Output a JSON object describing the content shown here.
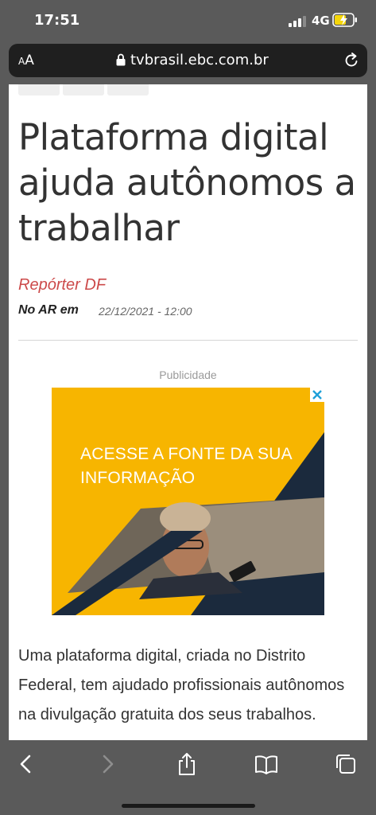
{
  "status_bar": {
    "time": "17:51",
    "network": "4G"
  },
  "browser": {
    "aa_small": "A",
    "aa_large": "A",
    "url": "tvbrasil.ebc.com.br"
  },
  "article": {
    "title": "Plataforma digital ajuda autônomos a trabalhar",
    "reporter": "Repórter DF",
    "on_air_label": "No AR em",
    "date": "22/12/2021 - 12:00",
    "ad_label": "Publicidade",
    "body": "Uma plataforma digital, criada no Distrito Federal, tem ajudado profissionais autônomos na divulgação gratuita dos seus trabalhos."
  },
  "ad": {
    "headline": "ACESSE A FONTE DA SUA INFORMAÇÃO"
  },
  "colors": {
    "accent": "#cc4a4a",
    "ad_background": "#f7b500",
    "ad_dark": "#1b2a3d"
  },
  "toolbar_icons": [
    "back-icon",
    "forward-icon",
    "share-icon",
    "bookmarks-icon",
    "tabs-icon"
  ]
}
